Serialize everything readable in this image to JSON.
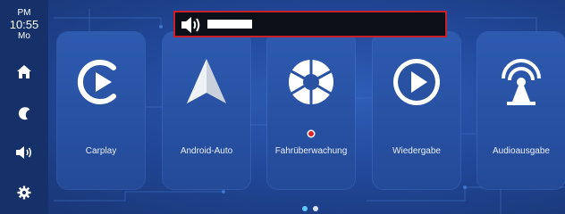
{
  "clock": {
    "ampm": "PM",
    "time": "10:55",
    "day": "Mo"
  },
  "sidebar": {
    "items": [
      {
        "icon": "home-icon"
      },
      {
        "icon": "moon-icon"
      },
      {
        "icon": "volume-icon"
      },
      {
        "icon": "gear-icon"
      }
    ]
  },
  "apps": [
    {
      "label": "Carplay",
      "icon": "carplay-icon"
    },
    {
      "label": "Android-Auto",
      "icon": "android-auto-icon"
    },
    {
      "label": "Fahrüberwachung",
      "icon": "camera-aperture-icon"
    },
    {
      "label": "Wiedergabe",
      "icon": "play-icon"
    },
    {
      "label": "Audioausgabe",
      "icon": "broadcast-icon"
    }
  ],
  "volume": {
    "level": 1.0
  },
  "pager": {
    "pages": 2,
    "active": 0
  },
  "colors": {
    "accent": "#5fc8ff",
    "record": "#e0202a",
    "volume_border": "#c8202a"
  }
}
